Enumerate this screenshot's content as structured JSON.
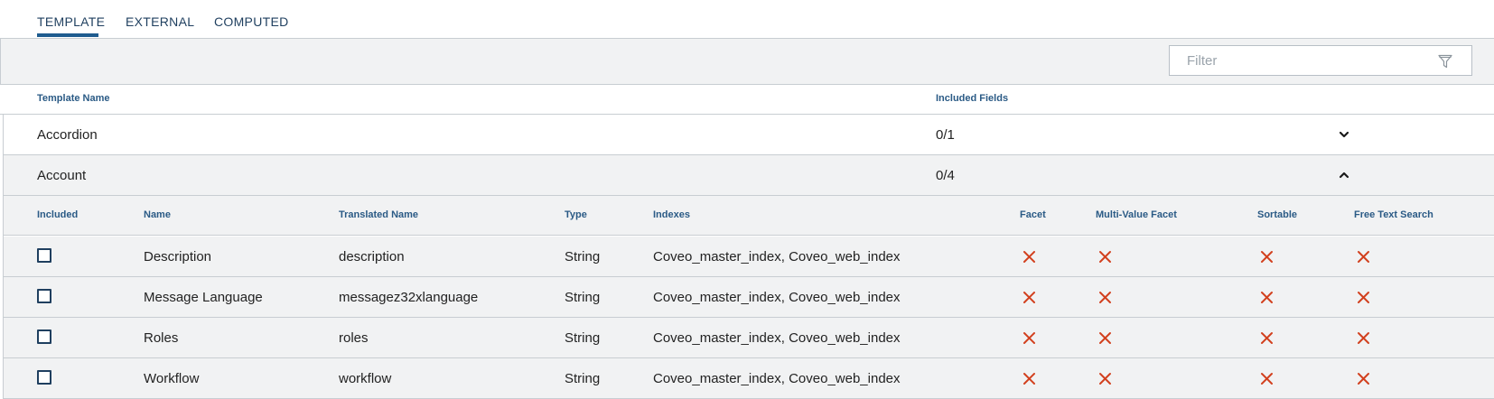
{
  "tabs": [
    {
      "label": "TEMPLATE",
      "active": true
    },
    {
      "label": "EXTERNAL",
      "active": false
    },
    {
      "label": "COMPUTED",
      "active": false
    }
  ],
  "filter": {
    "placeholder": "Filter",
    "value": "",
    "icon": "filter-funnel-icon"
  },
  "table": {
    "headers": {
      "template_name": "Template Name",
      "included_fields": "Included Fields"
    },
    "groups": [
      {
        "name": "Accordion",
        "count": "0/1",
        "expanded": false,
        "icon": "chevron-down-icon"
      },
      {
        "name": "Account",
        "count": "0/4",
        "expanded": true,
        "icon": "chevron-up-icon"
      }
    ]
  },
  "fields": {
    "headers": {
      "included": "Included",
      "name": "Name",
      "translated_name": "Translated Name",
      "type": "Type",
      "indexes": "Indexes",
      "facet": "Facet",
      "multi_value_facet": "Multi-Value Facet",
      "sortable": "Sortable",
      "free_text_search": "Free Text Search"
    },
    "rows": [
      {
        "included": false,
        "name": "Description",
        "translated_name": "description",
        "type": "String",
        "indexes": "Coveo_master_index, Coveo_web_index",
        "facet": false,
        "multi_value_facet": false,
        "sortable": false,
        "free_text_search": false
      },
      {
        "included": false,
        "name": "Message Language",
        "translated_name": "messagez32xlanguage",
        "type": "String",
        "indexes": "Coveo_master_index, Coveo_web_index",
        "facet": false,
        "multi_value_facet": false,
        "sortable": false,
        "free_text_search": false
      },
      {
        "included": false,
        "name": "Roles",
        "translated_name": "roles",
        "type": "String",
        "indexes": "Coveo_master_index, Coveo_web_index",
        "facet": false,
        "multi_value_facet": false,
        "sortable": false,
        "free_text_search": false
      },
      {
        "included": false,
        "name": "Workflow",
        "translated_name": "workflow",
        "type": "String",
        "indexes": "Coveo_master_index, Coveo_web_index",
        "facet": false,
        "multi_value_facet": false,
        "sortable": false,
        "free_text_search": false
      }
    ]
  },
  "colors": {
    "accent": "#1f5c8f",
    "header_text": "#2a5a85",
    "cross": "#d2401e",
    "panel_bg": "#f1f2f3"
  }
}
